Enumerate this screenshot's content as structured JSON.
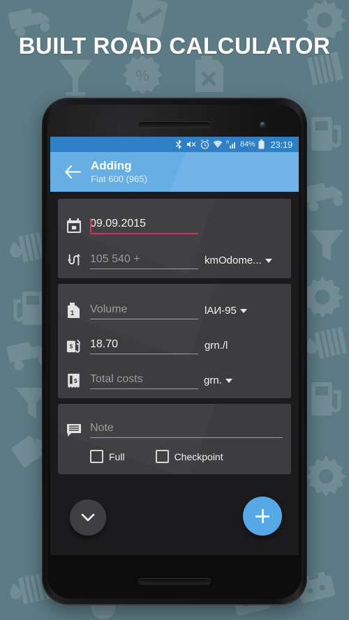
{
  "poster": {
    "title": "BUILT ROAD CALCULATOR",
    "bg_color": "#5d7b85",
    "background_icons": [
      "truck-icon",
      "cocktail-glass-icon",
      "percent-badge-icon",
      "jerrycan-x-icon",
      "check-document-icon",
      "gear-icon",
      "funnel-icon",
      "oil-drop-icon",
      "radiator-icon",
      "fuel-pump-icon",
      "paint-bucket-icon",
      "car-battery-icon"
    ]
  },
  "statusbar": {
    "icons": [
      "bluetooth-icon",
      "mute-icon",
      "alarm-icon",
      "wifi-icon",
      "cell-signal-roaming-icon",
      "battery-icon"
    ],
    "battery_percent": "84%",
    "time": "23:19",
    "bg_color": "#2f7fc4"
  },
  "appbar": {
    "back_icon": "back-arrow-icon",
    "title": "Adding",
    "subtitle": "Fiat 600 (965)",
    "bg_color": "#67aee5"
  },
  "cards": {
    "trip": {
      "date": {
        "icon": "calendar-icon",
        "value": "09.09.2015",
        "underline_color": "#e5225f",
        "focused": true
      },
      "odometer": {
        "icon": "road-arrows-icon",
        "placeholder": "105 540 +",
        "value": "",
        "unit": "km",
        "type_label": "Odome...",
        "type_caret": "chevron-down-icon"
      }
    },
    "fuel": {
      "volume": {
        "icon": "jerrycan-1-icon",
        "placeholder": "Volume",
        "value": "",
        "unit": "l",
        "fuel_grade": "АИ-95",
        "grade_caret": "chevron-down-icon"
      },
      "price": {
        "icon": "fuel-pump-price-icon",
        "placeholder": "",
        "value": "18.70",
        "unit": "grn./l"
      },
      "total": {
        "icon": "receipt-icon",
        "placeholder": "Total costs",
        "value": "",
        "currency": "grn.",
        "currency_caret": "chevron-down-icon"
      }
    },
    "note": {
      "icon": "comment-icon",
      "placeholder": "Note",
      "value": "",
      "checkboxes": [
        {
          "label": "Full",
          "checked": false
        },
        {
          "label": "Checkpoint",
          "checked": false
        }
      ]
    }
  },
  "fabs": {
    "collapse": {
      "icon": "chevron-down-icon",
      "color": "#3f3f41"
    },
    "add": {
      "icon": "plus-icon",
      "color": "#56a8e6"
    }
  }
}
